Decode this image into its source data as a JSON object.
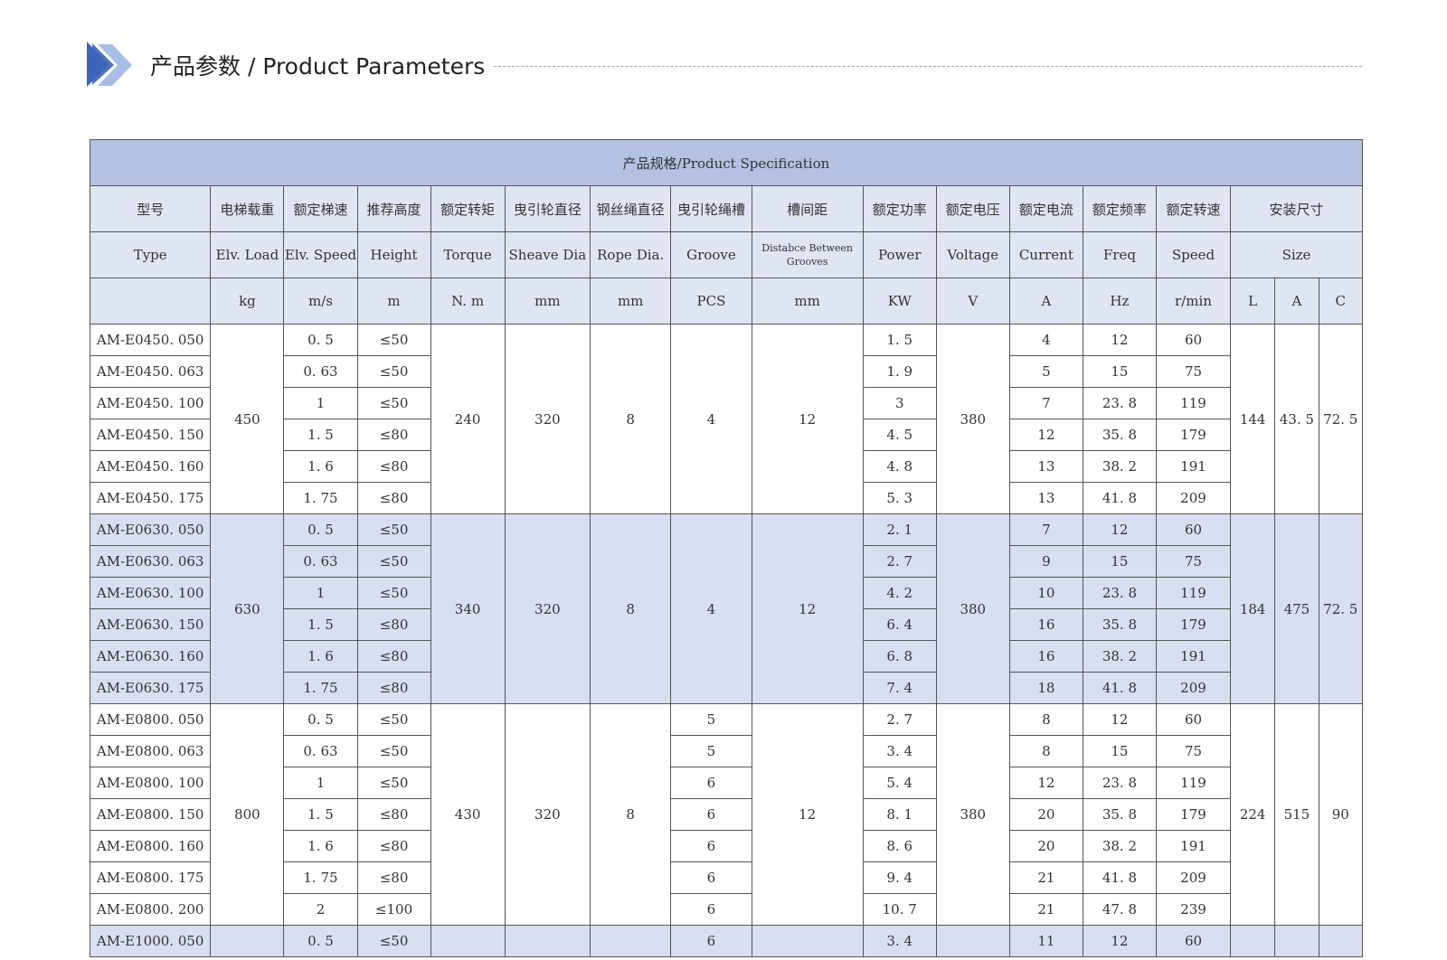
{
  "header": {
    "title": "产品参数 / Product Parameters"
  },
  "table": {
    "title": "产品规格/Product Specification",
    "headers_cn": [
      "型号",
      "电梯载重",
      "额定梯速",
      "推荐高度",
      "额定转矩",
      "曳引轮直径",
      "钢丝绳直径",
      "曳引轮绳槽",
      "槽间距",
      "额定功率",
      "额定电压",
      "额定电流",
      "额定频率",
      "额定转速",
      "安装尺寸"
    ],
    "headers_en": [
      "Type",
      "Elv. Load",
      "Elv. Speed",
      "Height",
      "Torque",
      "Sheave Dia",
      "Rope Dia.",
      "Groove",
      "Distabce Between Grooves",
      "Power",
      "Voltage",
      "Current",
      "Freq",
      "Speed",
      "Size"
    ],
    "units": [
      "",
      "kg",
      "m/s",
      "m",
      "N. m",
      "mm",
      "mm",
      "PCS",
      "mm",
      "KW",
      "V",
      "A",
      "Hz",
      "r/min",
      "L",
      "A",
      "C"
    ],
    "groups": [
      {
        "load": "450",
        "torque": "240",
        "sheave": "320",
        "rope": "8",
        "groove": "4",
        "spacing": "12",
        "voltage": "380",
        "size_l": "144",
        "size_a": "43. 5",
        "size_c": "72. 5",
        "rows": [
          {
            "type": "AM-E0450. 050",
            "speed": "0. 5",
            "height": "≤50",
            "power": "1. 5",
            "current": "4",
            "freq": "12",
            "rpm": "60"
          },
          {
            "type": "AM-E0450. 063",
            "speed": "0. 63",
            "height": "≤50",
            "power": "1. 9",
            "current": "5",
            "freq": "15",
            "rpm": "75"
          },
          {
            "type": "AM-E0450. 100",
            "speed": "1",
            "height": "≤50",
            "power": "3",
            "current": "7",
            "freq": "23. 8",
            "rpm": "119"
          },
          {
            "type": "AM-E0450. 150",
            "speed": "1. 5",
            "height": "≤80",
            "power": "4. 5",
            "current": "12",
            "freq": "35. 8",
            "rpm": "179"
          },
          {
            "type": "AM-E0450. 160",
            "speed": "1. 6",
            "height": "≤80",
            "power": "4. 8",
            "current": "13",
            "freq": "38. 2",
            "rpm": "191"
          },
          {
            "type": "AM-E0450. 175",
            "speed": "1. 75",
            "height": "≤80",
            "power": "5. 3",
            "current": "13",
            "freq": "41. 8",
            "rpm": "209"
          }
        ]
      },
      {
        "load": "630",
        "torque": "340",
        "sheave": "320",
        "rope": "8",
        "groove": "4",
        "spacing": "12",
        "voltage": "380",
        "size_l": "184",
        "size_a": "475",
        "size_c": "72. 5",
        "rows": [
          {
            "type": "AM-E0630. 050",
            "speed": "0. 5",
            "height": "≤50",
            "power": "2. 1",
            "current": "7",
            "freq": "12",
            "rpm": "60"
          },
          {
            "type": "AM-E0630. 063",
            "speed": "0. 63",
            "height": "≤50",
            "power": "2. 7",
            "current": "9",
            "freq": "15",
            "rpm": "75"
          },
          {
            "type": "AM-E0630. 100",
            "speed": "1",
            "height": "≤50",
            "power": "4. 2",
            "current": "10",
            "freq": "23. 8",
            "rpm": "119"
          },
          {
            "type": "AM-E0630. 150",
            "speed": "1. 5",
            "height": "≤80",
            "power": "6. 4",
            "current": "16",
            "freq": "35. 8",
            "rpm": "179"
          },
          {
            "type": "AM-E0630. 160",
            "speed": "1. 6",
            "height": "≤80",
            "power": "6. 8",
            "current": "16",
            "freq": "38. 2",
            "rpm": "191"
          },
          {
            "type": "AM-E0630. 175",
            "speed": "1. 75",
            "height": "≤80",
            "power": "7. 4",
            "current": "18",
            "freq": "41. 8",
            "rpm": "209"
          }
        ]
      },
      {
        "load": "800",
        "torque": "430",
        "sheave": "320",
        "rope": "8",
        "spacing": "12",
        "voltage": "380",
        "size_l": "224",
        "size_a": "515",
        "size_c": "90",
        "rows": [
          {
            "type": "AM-E0800. 050",
            "speed": "0. 5",
            "height": "≤50",
            "groove": "5",
            "power": "2. 7",
            "current": "8",
            "freq": "12",
            "rpm": "60"
          },
          {
            "type": "AM-E0800. 063",
            "speed": "0. 63",
            "height": "≤50",
            "groove": "5",
            "power": "3. 4",
            "current": "8",
            "freq": "15",
            "rpm": "75"
          },
          {
            "type": "AM-E0800. 100",
            "speed": "1",
            "height": "≤50",
            "groove": "6",
            "power": "5. 4",
            "current": "12",
            "freq": "23. 8",
            "rpm": "119"
          },
          {
            "type": "AM-E0800. 150",
            "speed": "1. 5",
            "height": "≤80",
            "groove": "6",
            "power": "8. 1",
            "current": "20",
            "freq": "35. 8",
            "rpm": "179"
          },
          {
            "type": "AM-E0800. 160",
            "speed": "1. 6",
            "height": "≤80",
            "groove": "6",
            "power": "8. 6",
            "current": "20",
            "freq": "38. 2",
            "rpm": "191"
          },
          {
            "type": "AM-E0800. 175",
            "speed": "1. 75",
            "height": "≤80",
            "groove": "6",
            "power": "9. 4",
            "current": "21",
            "freq": "41. 8",
            "rpm": "209"
          },
          {
            "type": "AM-E0800. 200",
            "speed": "2",
            "height": "≤100",
            "groove": "6",
            "power": "10. 7",
            "current": "21",
            "freq": "47. 8",
            "rpm": "239"
          }
        ]
      },
      {
        "rows": [
          {
            "type": "AM-E1000. 050",
            "speed": "0. 5",
            "height": "≤50",
            "groove": "6",
            "power": "3. 4",
            "current": "11",
            "freq": "12",
            "rpm": "60"
          }
        ]
      }
    ]
  },
  "colors": {
    "title_band": "#b3c2e2",
    "header_band": "#dfe5f3",
    "alt_band": "#d8dff0",
    "chevron_dark": "#3d63b8",
    "chevron_light": "#a9bde6",
    "dashed_line": "#9aa6c8"
  }
}
